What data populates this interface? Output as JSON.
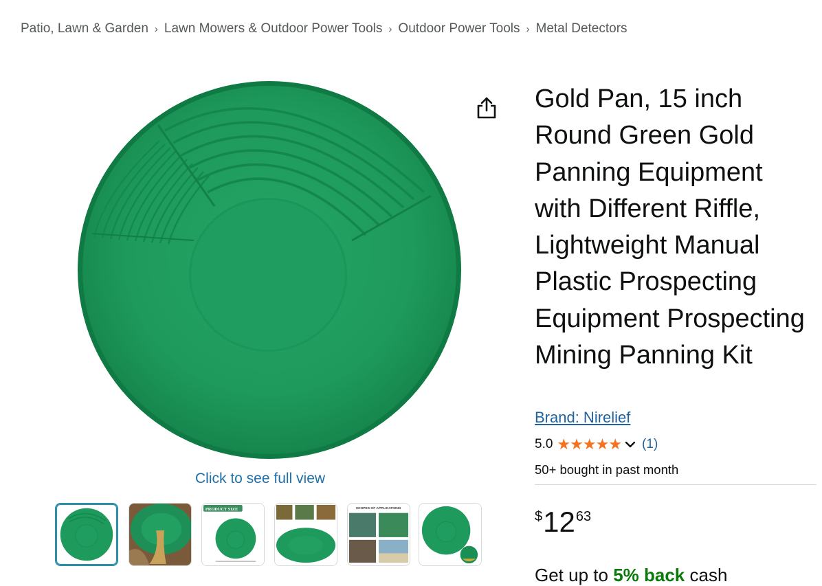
{
  "breadcrumb": {
    "items": [
      "Patio, Lawn & Garden",
      "Lawn Mowers & Outdoor Power Tools",
      "Outdoor Power Tools",
      "Metal Detectors"
    ],
    "separator": "›"
  },
  "gallery": {
    "full_view_label": "Click to see full view",
    "thumb_labels": {
      "product_size": "PRODUCT SIZE",
      "applications": "SCOPES OF APPLICATIONS"
    }
  },
  "product": {
    "title": "Gold Pan, 15 inch Round Green Gold Panning Equipment with Different Riffle, Lightweight Manual Plastic Prospecting Equipment Prospecting Mining Panning Kit",
    "brand": "Brand: Nirelief",
    "rating": "5.0",
    "stars": "★★★★★",
    "rating_fraction": 1.0,
    "rating_count": "(1)",
    "bought": "50+ bought in past month",
    "price_symbol": "$",
    "price_whole": "12",
    "price_fraction": "63",
    "cashback_prefix": "Get up to",
    "cashback_highlight": "5% back",
    "cashback_suffix": "cash"
  },
  "colors": {
    "pan_green": "#1f9a5c",
    "link": "#2162a1",
    "star": "#f4711f",
    "selected_thumb": "#2b8fa8"
  },
  "icons": {
    "share": "share-icon",
    "chevron": "chevron-down-icon"
  }
}
